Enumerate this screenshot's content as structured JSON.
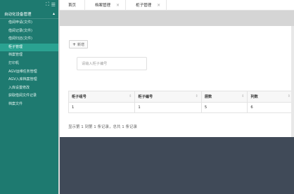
{
  "sidebar": {
    "top_icons": [
      "expand-icon",
      "menu-icon"
    ],
    "group_title": "自动化设备管理",
    "items": [
      {
        "label": "借阅申请(文件)"
      },
      {
        "label": "借阅记录(文件)"
      },
      {
        "label": "借阅归还(文件)"
      },
      {
        "label": "柜子管理",
        "active": true
      },
      {
        "label": "档案管理"
      },
      {
        "label": "打印机"
      },
      {
        "label": "AGV运维任务管理"
      },
      {
        "label": "AGV入库档案管理"
      },
      {
        "label": "入库设置修改"
      },
      {
        "label": "获取借阅文件记录"
      },
      {
        "label": "档案文件"
      }
    ]
  },
  "tabs": [
    {
      "label": "首页",
      "closable": false
    },
    {
      "label": "档案管理",
      "closable": true
    },
    {
      "label": "柜子管理",
      "closable": true
    }
  ],
  "toolbar": {
    "add_label": "新增"
  },
  "search": {
    "placeholder": "请输入柜子编号"
  },
  "table": {
    "columns": [
      "柜子组号",
      "柜子编号",
      "层数",
      "列数"
    ],
    "rows": [
      [
        "1",
        "1",
        "5",
        "6"
      ]
    ]
  },
  "pager": {
    "summary": "显示第 1 到第 1 条记录，总共 1 条记录"
  },
  "colors": {
    "sidebar": "#1e7a70",
    "active": "#2aa291",
    "footer": "#404a58"
  }
}
